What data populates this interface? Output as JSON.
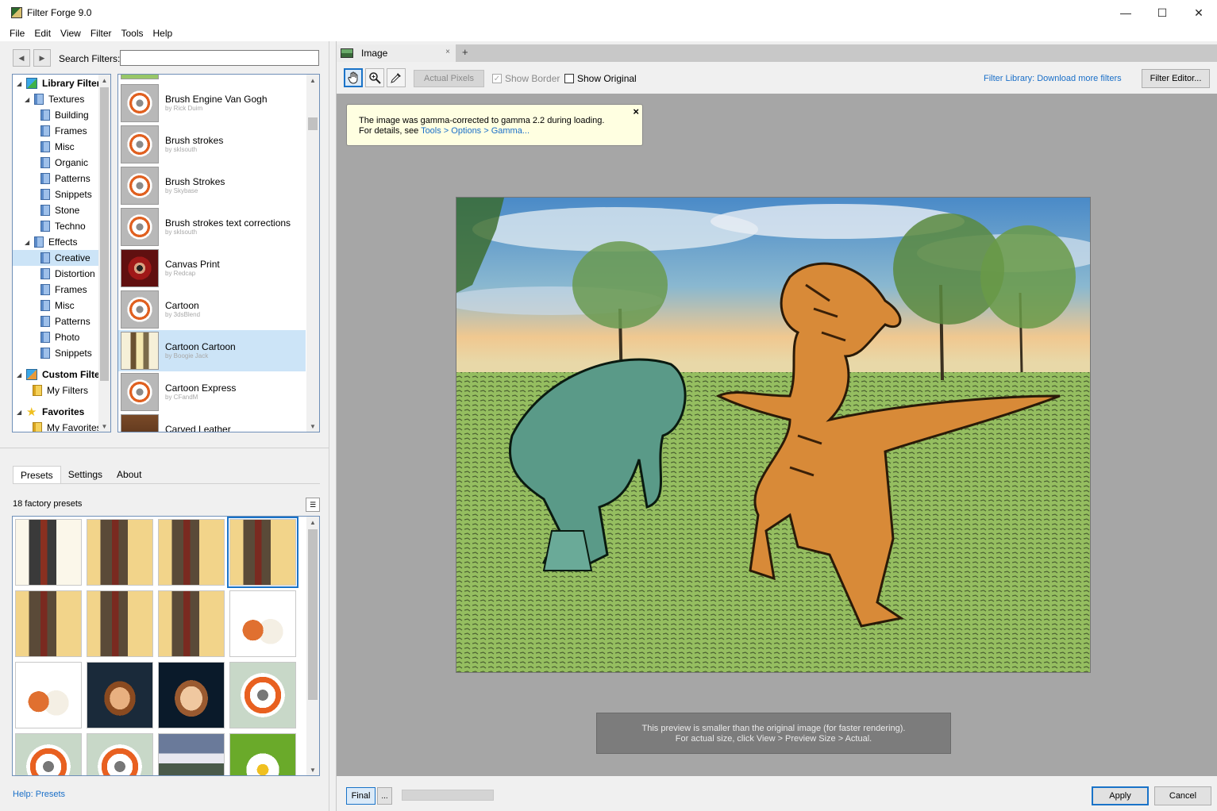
{
  "window": {
    "title": "Filter Forge 9.0",
    "controls": [
      "—",
      "☐",
      "✕"
    ]
  },
  "menu": [
    "File",
    "Edit",
    "View",
    "Filter",
    "Tools",
    "Help"
  ],
  "search": {
    "label": "Search Filters:",
    "value": "",
    "placeholder": ""
  },
  "tree": [
    {
      "label": "Library Filters",
      "bold": true,
      "icon": "cube-icon"
    },
    {
      "label": "Textures",
      "icon": "folder-icon"
    },
    {
      "label": "Building",
      "icon": "folder-icon"
    },
    {
      "label": "Frames",
      "icon": "folder-icon"
    },
    {
      "label": "Misc",
      "icon": "folder-icon"
    },
    {
      "label": "Organic",
      "icon": "folder-icon"
    },
    {
      "label": "Patterns",
      "icon": "folder-icon"
    },
    {
      "label": "Snippets",
      "icon": "folder-icon"
    },
    {
      "label": "Stone",
      "icon": "folder-icon"
    },
    {
      "label": "Techno",
      "icon": "folder-icon"
    },
    {
      "label": "Effects",
      "icon": "folder-icon"
    },
    {
      "label": "Creative",
      "icon": "folder-icon",
      "selected": true
    },
    {
      "label": "Distortion",
      "icon": "folder-icon"
    },
    {
      "label": "Frames",
      "icon": "folder-icon"
    },
    {
      "label": "Misc",
      "icon": "folder-icon"
    },
    {
      "label": "Patterns",
      "icon": "folder-icon"
    },
    {
      "label": "Photo",
      "icon": "folder-icon"
    },
    {
      "label": "Snippets",
      "icon": "folder-icon"
    },
    {
      "label": "Custom Filters",
      "bold": true,
      "icon": "cube-icon"
    },
    {
      "label": "My Filters",
      "icon": "folder-icon"
    },
    {
      "label": "Favorites",
      "bold": true,
      "icon": "star-icon"
    },
    {
      "label": "My Favorites",
      "icon": "folder-icon"
    }
  ],
  "filters": [
    {
      "name": "Brush Engine Van Gogh",
      "author": "by Rick Duim"
    },
    {
      "name": "Brush strokes",
      "author": "by sklsouth"
    },
    {
      "name": "Brush Strokes",
      "author": "by Skybase"
    },
    {
      "name": "Brush strokes text corrections",
      "author": "by sklsouth"
    },
    {
      "name": "Canvas Print",
      "author": "by Redcap"
    },
    {
      "name": "Cartoon",
      "author": "by 3dsBlend"
    },
    {
      "name": "Cartoon Cartoon",
      "author": "by Boogie Jack",
      "selected": true
    },
    {
      "name": "Cartoon Express",
      "author": "by CFandM"
    },
    {
      "name": "Carved Leather",
      "author": ""
    }
  ],
  "tabs": [
    "Presets",
    "Settings",
    "About"
  ],
  "presets_count": "18 factory presets",
  "help_link": "Help: Presets",
  "doc_tab": {
    "label": "Image",
    "close": "×",
    "add": "+"
  },
  "toolbar": {
    "actual_pixels": "Actual Pixels",
    "show_border": "Show Border",
    "show_original": "Show Original",
    "library_link": "Filter Library: Download more filters",
    "filter_editor": "Filter Editor..."
  },
  "notice": {
    "line1": "The image was gamma-corrected to gamma 2.2 during loading.",
    "line2_prefix": "For details, see ",
    "line2_link": "Tools > Options > Gamma...",
    "close": "×"
  },
  "preview_note": {
    "line1": "This preview is smaller than the original image (for faster rendering).",
    "line2": "For actual size, click View > Preview Size > Actual."
  },
  "bottom": {
    "final": "Final",
    "dots": "...",
    "apply": "Apply",
    "cancel": "Cancel"
  },
  "render_progress": 0
}
